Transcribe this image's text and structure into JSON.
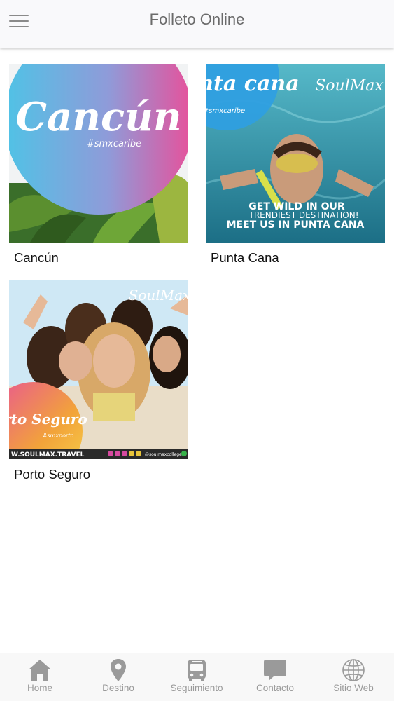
{
  "header": {
    "title": "Folleto Online",
    "menu_icon": "hamburger-menu-icon"
  },
  "destinations": [
    {
      "label": "Cancún",
      "image_text": {
        "title": "Cancún",
        "hashtag": "#smxcaribe"
      }
    },
    {
      "label": "Punta Cana",
      "image_text": {
        "title": "punta cana",
        "hashtag": "#smxcaribe",
        "brand": "SoulMax",
        "line1": "GET WILD IN OUR",
        "line2": "TRENDIEST DESTINATION!",
        "line3": "MEET US IN PUNTA CANA"
      }
    },
    {
      "label": "Porto Seguro",
      "image_text": {
        "title": "Porto Seguro",
        "hashtag": "#smxporto",
        "brand": "SoulMax",
        "website": "W.SOULMAX.TRAVEL",
        "handle": "@soulmaxcollege"
      }
    }
  ],
  "tabbar": {
    "items": [
      {
        "label": "Home",
        "icon": "home-icon"
      },
      {
        "label": "Destino",
        "icon": "location-pin-icon"
      },
      {
        "label": "Seguimiento",
        "icon": "bus-icon"
      },
      {
        "label": "Contacto",
        "icon": "chat-bubble-icon"
      },
      {
        "label": "Sitio Web",
        "icon": "globe-icon"
      }
    ]
  },
  "colors": {
    "header_bg": "#f9f9fb",
    "title_text": "#6b6b6b",
    "tab_inactive": "#9a9a9a",
    "cancun_gradient_start": "#4fc3e6",
    "cancun_gradient_end": "#e8509a",
    "punta_cana_water": "#2a8fa8"
  }
}
